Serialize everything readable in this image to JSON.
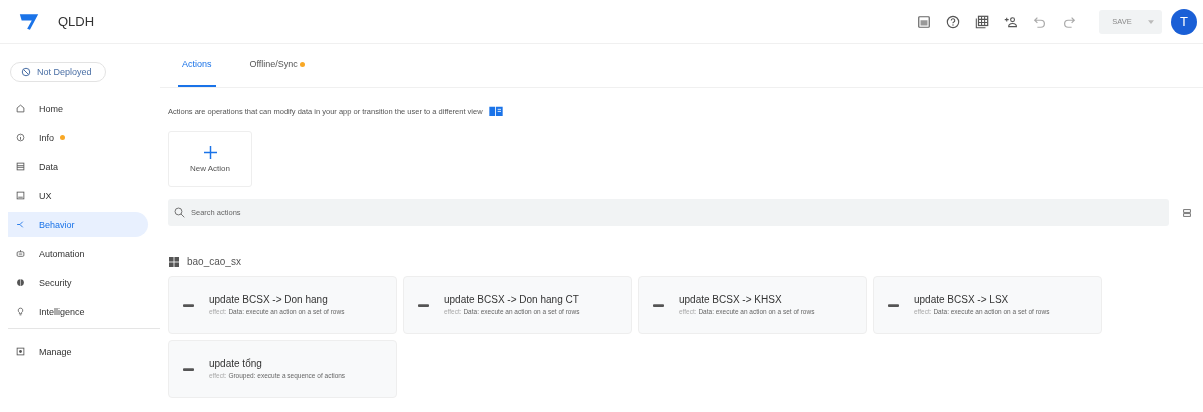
{
  "app": {
    "title": "QLDH"
  },
  "toolbar": {
    "save": {
      "label": "SAVE",
      "disabled": true
    },
    "avatar": "T"
  },
  "deploy_status": "Not Deployed",
  "sidebar": {
    "groups": [
      [
        {
          "label": "Home",
          "dot": false,
          "selected": false
        },
        {
          "label": "Info",
          "dot": true,
          "selected": false
        },
        {
          "label": "Data",
          "dot": false,
          "selected": false
        },
        {
          "label": "UX",
          "dot": false,
          "selected": false
        },
        {
          "label": "Behavior",
          "dot": false,
          "selected": true
        },
        {
          "label": "Automation",
          "dot": false,
          "selected": false
        },
        {
          "label": "Security",
          "dot": false,
          "selected": false
        },
        {
          "label": "Intelligence",
          "dot": false,
          "selected": false
        }
      ],
      [
        {
          "label": "Manage",
          "dot": false,
          "selected": false
        }
      ]
    ]
  },
  "tabs": [
    {
      "label": "Actions",
      "selected": true,
      "dot": false
    },
    {
      "label": "Offline/Sync",
      "selected": false,
      "dot": true
    }
  ],
  "description": "Actions are operations that can modify data in your app or transition the user to a different view",
  "new_action": "New Action",
  "search": {
    "placeholder": "Search actions"
  },
  "groups": [
    {
      "table": "bao_cao_sx",
      "actions": [
        {
          "name": "update BCSX -> Don hang",
          "effect_label": "effect:",
          "effect": "Data: execute an action on a set of rows"
        },
        {
          "name": "update BCSX -> Don hang CT",
          "effect_label": "effect:",
          "effect": "Data: execute an action on a set of rows"
        },
        {
          "name": "update BCSX -> KHSX",
          "effect_label": "effect:",
          "effect": "Data: execute an action on a set of rows"
        },
        {
          "name": "update BCSX -> LSX",
          "effect_label": "effect:",
          "effect": "Data: execute an action on a set of rows"
        },
        {
          "name": "update tổng",
          "effect_label": "effect:",
          "effect": "Grouped: execute a sequence of actions"
        }
      ]
    }
  ]
}
